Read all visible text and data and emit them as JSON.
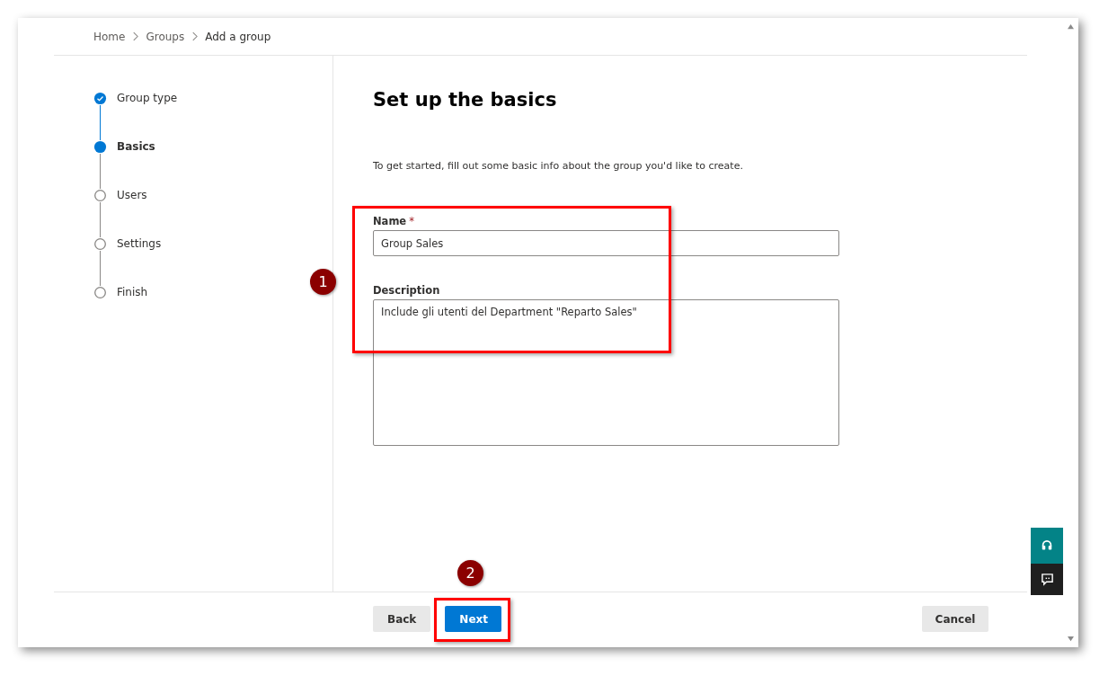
{
  "breadcrumb": [
    {
      "label": "Home",
      "current": false
    },
    {
      "label": "Groups",
      "current": false
    },
    {
      "label": "Add a group",
      "current": true
    }
  ],
  "steps": [
    {
      "label": "Group type",
      "completed": true,
      "current": false
    },
    {
      "label": "Basics",
      "completed": false,
      "current": true
    },
    {
      "label": "Users",
      "completed": false,
      "current": false
    },
    {
      "label": "Settings",
      "completed": false,
      "current": false
    },
    {
      "label": "Finish",
      "completed": false,
      "current": false
    }
  ],
  "title": "Set up the basics",
  "intro": "To get started, fill out some basic info about the group you'd like to create.",
  "name_field": {
    "label": "Name",
    "required_mark": "*",
    "value": "Group Sales"
  },
  "description_field": {
    "label": "Description",
    "value": "Include gli utenti del Department \"Reparto Sales\""
  },
  "footer": {
    "back": "Back",
    "next": "Next",
    "cancel": "Cancel"
  },
  "annotations": [
    {
      "label": "1"
    },
    {
      "label": "2"
    }
  ]
}
